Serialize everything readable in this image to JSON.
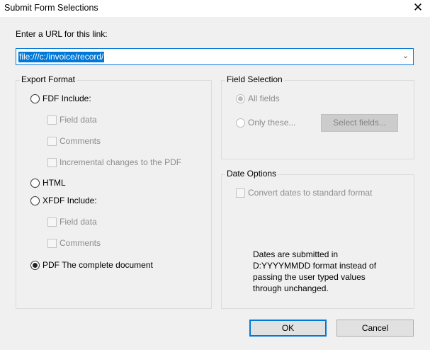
{
  "window": {
    "title": "Submit Form Selections"
  },
  "url": {
    "label": "Enter a URL for this link:",
    "value": "file:///c:/invoice/record/"
  },
  "export_format": {
    "legend": "Export Format",
    "options": [
      {
        "label": "FDF  Include:",
        "selected": false,
        "subs": [
          "Field data",
          "Comments",
          "Incremental changes to the PDF"
        ]
      },
      {
        "label": "HTML",
        "selected": false,
        "subs": []
      },
      {
        "label": "XFDF  Include:",
        "selected": false,
        "subs": [
          "Field data",
          "Comments"
        ]
      },
      {
        "label": "PDF  The complete document",
        "selected": true,
        "subs": []
      }
    ]
  },
  "field_selection": {
    "legend": "Field Selection",
    "all": "All fields",
    "only": "Only these...",
    "select_button": "Select fields..."
  },
  "date_options": {
    "legend": "Date Options",
    "convert": "Convert dates to standard format",
    "note": [
      "Dates are submitted in",
      "D:YYYYMMDD format instead of",
      "passing the user typed values",
      "through unchanged."
    ]
  },
  "buttons": {
    "ok": "OK",
    "cancel": "Cancel"
  }
}
